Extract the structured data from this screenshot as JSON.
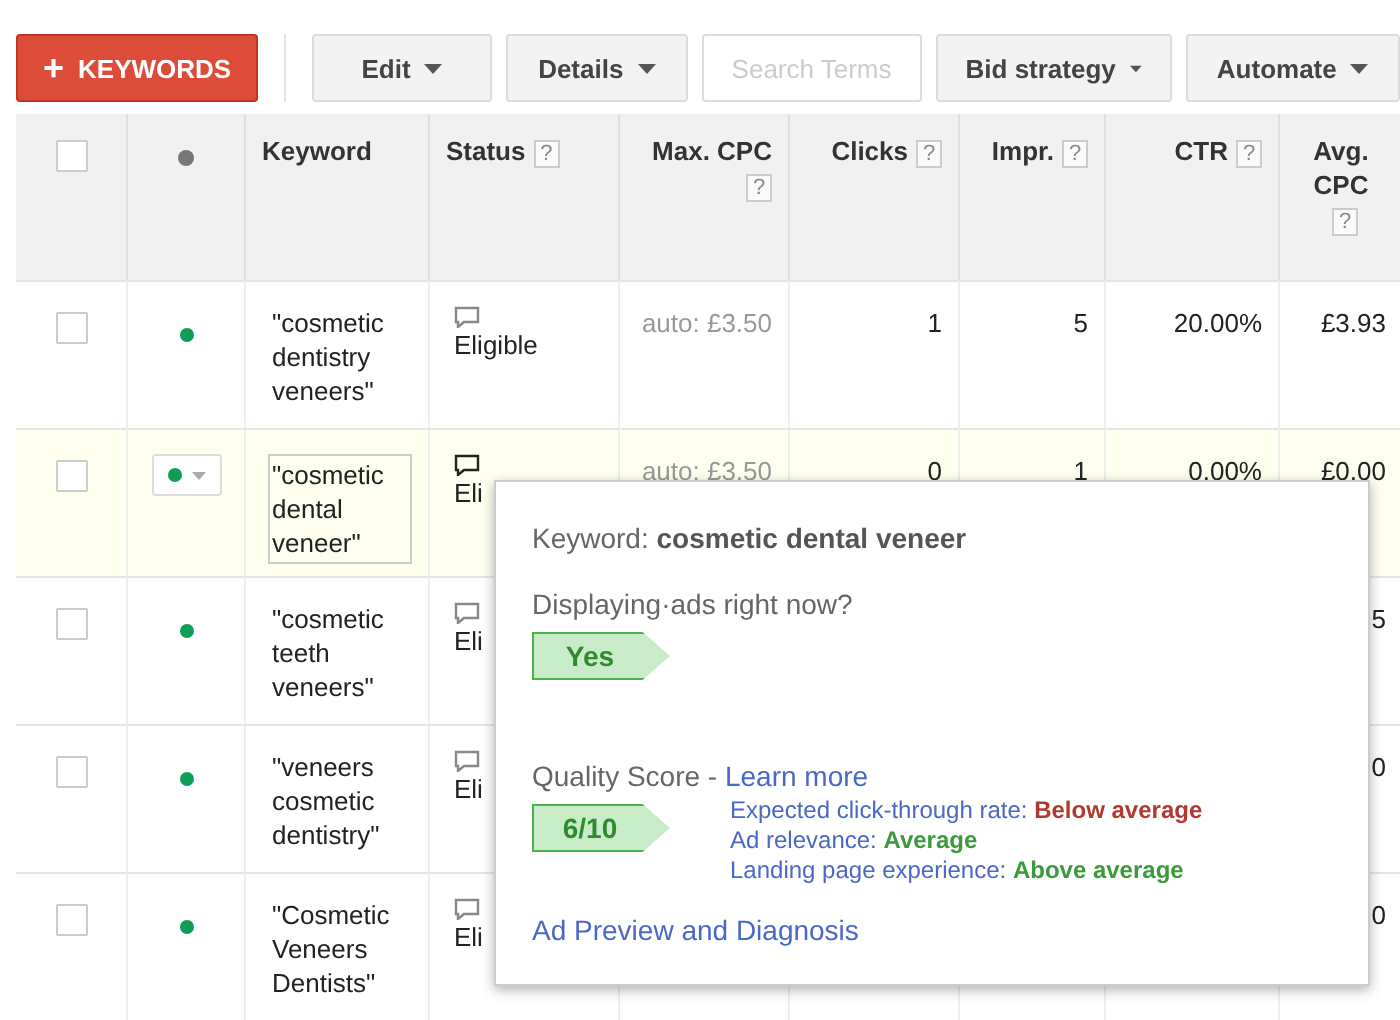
{
  "toolbar": {
    "add_button": {
      "icon": "+",
      "label": "KEYWORDS"
    },
    "buttons": [
      {
        "label": "Edit",
        "dropdown": true,
        "disabled": false
      },
      {
        "label": "Details",
        "dropdown": true,
        "disabled": false
      },
      {
        "label": "Search Terms",
        "dropdown": false,
        "disabled": true
      },
      {
        "label": "Bid strategy",
        "dropdown": true,
        "disabled": false
      },
      {
        "label": "Automate",
        "dropdown": true,
        "disabled": false
      }
    ]
  },
  "table": {
    "columns": [
      {
        "kind": "check",
        "checked": false
      },
      {
        "kind": "dot"
      },
      {
        "kind": "text",
        "label": "Keyword"
      },
      {
        "kind": "text",
        "label": "Status",
        "help": "?"
      },
      {
        "kind": "text",
        "label": "Max. CPC",
        "help": "?"
      },
      {
        "kind": "text",
        "label": "Clicks",
        "help": "?"
      },
      {
        "kind": "text",
        "label": "Impr.",
        "help": "?"
      },
      {
        "kind": "text",
        "label": "CTR",
        "help": "?"
      },
      {
        "kind": "text",
        "label": "Avg. CPC",
        "help": "?"
      }
    ],
    "rows": [
      {
        "selected": false,
        "checked": false,
        "color": "#0f9d58",
        "keyword": "\"cosmetic dentistry veneers\"",
        "status": "Eligible",
        "max_cpc": "auto: £3.50",
        "clicks": "1",
        "impr": "5",
        "ctr": "20.00%",
        "avg_cpc": "£3.93"
      },
      {
        "selected": true,
        "checked": false,
        "color": "#0f9d58",
        "keyword": "\"cosmetic dental veneer\"",
        "status": "Eli",
        "max_cpc": "auto: £3.50",
        "clicks": "0",
        "impr": "1",
        "ctr": "0.00%",
        "avg_cpc": "£0.00"
      },
      {
        "selected": false,
        "checked": false,
        "color": "#0f9d58",
        "keyword": "\"cosmetic teeth veneers\"",
        "status": "Eli",
        "avg_cpc": "5"
      },
      {
        "selected": false,
        "checked": false,
        "color": "#0f9d58",
        "keyword": "\"veneers cosmetic dentistry\"",
        "status": "Eli",
        "avg_cpc": "0"
      },
      {
        "selected": false,
        "checked": false,
        "color": "#0f9d58",
        "keyword": "\"Cosmetic Veneers Dentists\"",
        "status": "Eli",
        "avg_cpc": "0"
      }
    ]
  },
  "popup": {
    "keyword_label": "Keyword:",
    "keyword": "cosmetic dental veneer",
    "displaying_label": "Displaying·ads right now?",
    "displaying": "Yes",
    "quality_label": "Quality Score -",
    "learn_more": "Learn more",
    "score": "6/10",
    "factors": [
      {
        "label": "Expected click-through rate:",
        "value": "Below average",
        "color": "#b03a2e"
      },
      {
        "label": "Ad relevance:",
        "value": "Average",
        "color": "#3c9a3c"
      },
      {
        "label": "Landing page experience:",
        "value": "Above average",
        "color": "#3c9a3c"
      }
    ],
    "link": "Ad Preview and Diagnosis"
  }
}
